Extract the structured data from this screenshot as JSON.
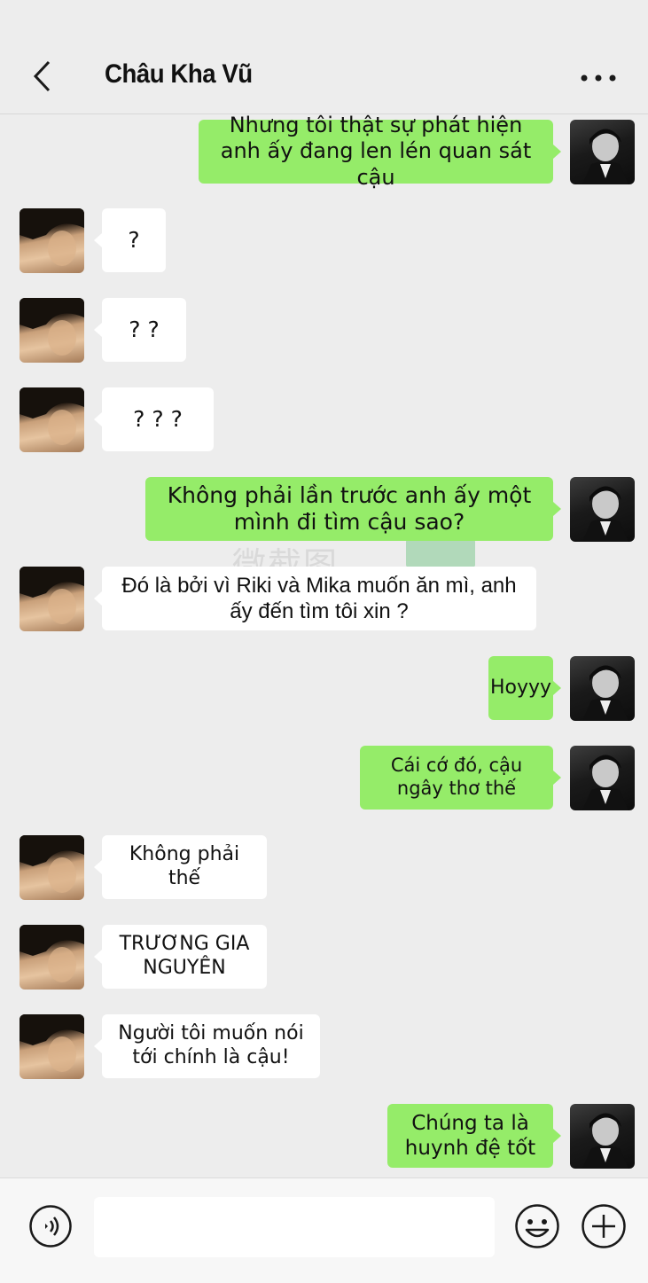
{
  "header": {
    "title": "Châu Kha Vũ",
    "back_icon": "chevron-left-icon",
    "more_icon": "more-dots-icon"
  },
  "messages": [
    {
      "side": "right",
      "text": "Nhưng tôi thật sự phát hiện anh ấy đang len lén quan sát cậu"
    },
    {
      "side": "left",
      "text": "?"
    },
    {
      "side": "left",
      "text": "? ?"
    },
    {
      "side": "left",
      "text": "? ? ?"
    },
    {
      "side": "right",
      "text": "Không phải lần trước anh ấy một mình đi tìm cậu sao?"
    },
    {
      "side": "left",
      "text": "Đó là bởi vì Riki và Mika muốn ăn mì, anh ấy đến tìm tôi xin ?"
    },
    {
      "side": "right",
      "text": "Hoyyy"
    },
    {
      "side": "right",
      "text": "Cái cớ đó, cậu ngây thơ thế"
    },
    {
      "side": "left",
      "text": "Không phải thế"
    },
    {
      "side": "left",
      "text": "TRƯƠNG GIA NGUYÊN"
    },
    {
      "side": "left",
      "text": "Người tôi muốn nói tới chính là cậu!"
    },
    {
      "side": "right",
      "text": "Chúng ta là huynh đệ tốt"
    }
  ],
  "watermark": {
    "text": "微截图"
  },
  "input_bar": {
    "placeholder": "",
    "voice_icon": "voice-icon",
    "emoji_icon": "emoji-icon",
    "plus_icon": "plus-icon"
  },
  "colors": {
    "background": "#ededed",
    "bubble_sent": "#95ec69",
    "bubble_received": "#ffffff"
  }
}
